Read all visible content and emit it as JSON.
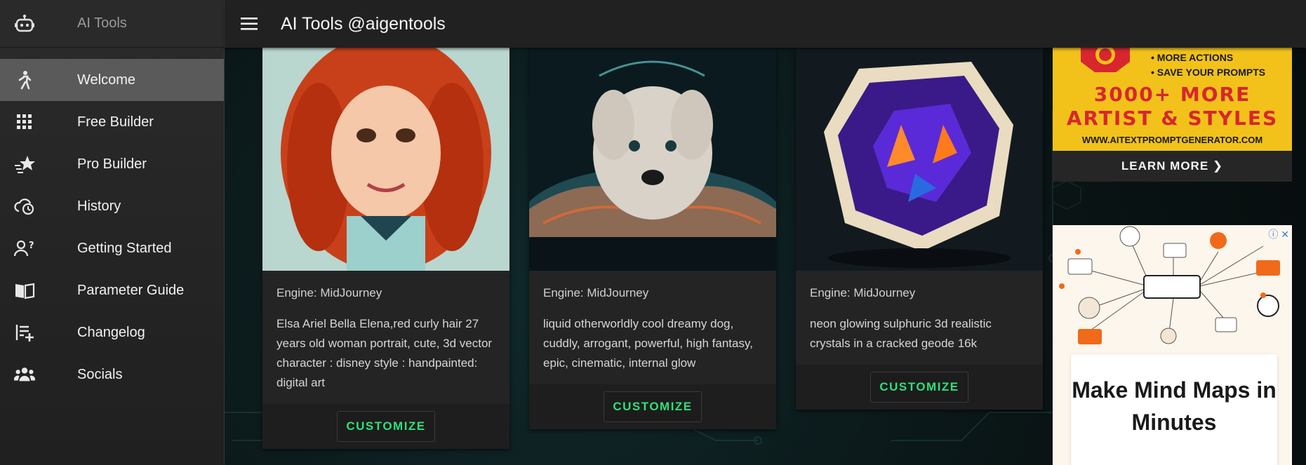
{
  "sidebar": {
    "brand": "AI Tools",
    "logo_icon": "robot-icon",
    "items": [
      {
        "label": "Welcome",
        "icon": "person-walking-icon",
        "active": true
      },
      {
        "label": "Free Builder",
        "icon": "grid-icon",
        "active": false
      },
      {
        "label": "Pro Builder",
        "icon": "star-speed-icon",
        "active": false
      },
      {
        "label": "History",
        "icon": "cloud-clock-icon",
        "active": false
      },
      {
        "label": "Getting Started",
        "icon": "person-question-icon",
        "active": false
      },
      {
        "label": "Parameter Guide",
        "icon": "book-icon",
        "active": false
      },
      {
        "label": "Changelog",
        "icon": "list-add-icon",
        "active": false
      },
      {
        "label": "Socials",
        "icon": "people-icon",
        "active": false
      }
    ]
  },
  "header": {
    "menu_icon": "hamburger-icon",
    "title": "AI Tools @aigentools"
  },
  "cards": [
    {
      "engine": "Engine: MidJourney",
      "prompt": "Elsa Ariel Bella Elena,red curly hair 27 years old woman portrait, cute, 3d vector character : disney style : handpainted: digital art",
      "button": "CUSTOMIZE"
    },
    {
      "engine": "Engine: MidJourney",
      "prompt": "liquid otherworldly cool dreamy dog, cuddly, arrogant, powerful, high fantasy, epic, cinematic, internal glow",
      "button": "CUSTOMIZE"
    },
    {
      "engine": "Engine: MidJourney",
      "prompt": "neon glowing sulphuric 3d realistic crystals in a cracked geode 16k",
      "button": "CUSTOMIZE"
    }
  ],
  "ads": {
    "top": {
      "bullet1": "• MORE ACTIONS",
      "bullet2": "• SAVE YOUR PROMPTS",
      "line1": "3000+ MORE",
      "line2": "ARTIST & STYLES",
      "url": "WWW.AITEXTPROMPTGENERATOR.COM",
      "cta": "LEARN MORE ❯"
    },
    "bottom": {
      "info": "ⓘ ✕",
      "headline": "Make Mind Maps in Minutes"
    }
  },
  "colors": {
    "accent": "#2ee07a",
    "sidebar_active": "#5a5a5a",
    "topbar": "#212121",
    "ad_yellow": "#f2c21a",
    "ad_red": "#d8262e"
  }
}
